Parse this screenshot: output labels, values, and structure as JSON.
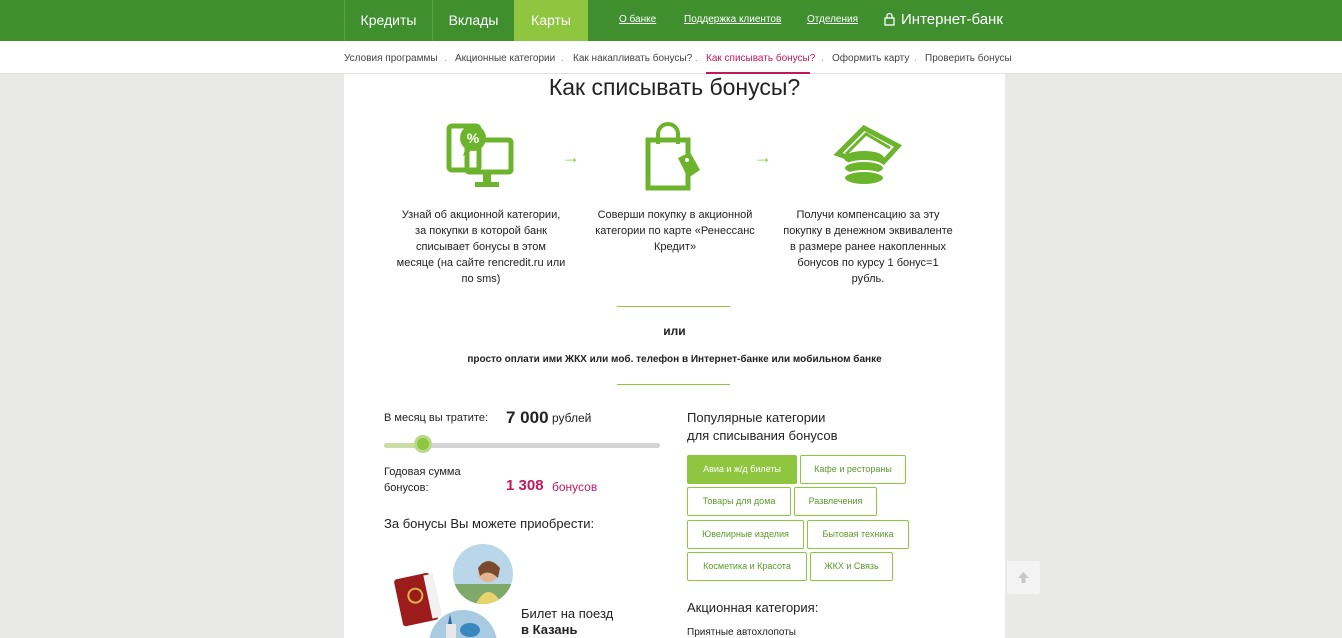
{
  "topnav": {
    "tabs": [
      {
        "label": "Кредиты",
        "active": false
      },
      {
        "label": "Вклады",
        "active": false
      },
      {
        "label": "Карты",
        "active": true
      }
    ],
    "links": [
      "О банке",
      "Поддержка клиентов",
      "Отделения"
    ],
    "internet_bank": "Интернет-банк"
  },
  "subnav": {
    "items": [
      {
        "label": "Условия программы",
        "active": false
      },
      {
        "label": "Акционные категории",
        "active": false
      },
      {
        "label": "Как накапливать бонусы?",
        "active": false
      },
      {
        "label": "Как списывать бонусы?",
        "active": true
      },
      {
        "label": "Оформить карту",
        "active": false
      },
      {
        "label": "Проверить бонусы",
        "active": false
      }
    ]
  },
  "main": {
    "heading": "Как списывать бонусы?",
    "steps": [
      {
        "icon": "device-discount-icon",
        "text": "Узнай об акционной категории, за покупки в которой банк списывает бонусы в этом месяце (на сайте rencredit.ru или по sms)"
      },
      {
        "icon": "shopping-bag-icon",
        "text": "Соверши покупку в акционной категории по карте «Ренессанс Кредит»"
      },
      {
        "icon": "coins-icon",
        "text": "Получи компенсацию за эту покупку в денежном эквиваленте в размере ранее накопленных бонусов по курсу 1 бонус=1 рубль."
      }
    ],
    "arrow": "→",
    "or": "или",
    "simply": "просто оплати ими ЖКХ или моб. телефон в Интернет-банке или мобильном банке"
  },
  "calculator": {
    "spend_label": "В месяц вы тратите:",
    "spend_value": "7 000",
    "spend_unit": "рублей",
    "slider_fraction": 0.14,
    "annual_label": "Годовая сумма бонусов:",
    "annual_value": "1 308",
    "annual_unit": "бонусов",
    "buy_title": "За бонусы Вы можете приобрести:",
    "offer_line1": "Билет на поезд",
    "offer_line2": "в Казань"
  },
  "categories": {
    "title_line1": "Популярные категории",
    "title_line2": "для списывания бонусов",
    "chips": [
      {
        "label": "Авиа и ж/д билеты",
        "active": true
      },
      {
        "label": "Кафе и рестораны",
        "active": false
      },
      {
        "label": "Товары для дома",
        "active": false
      },
      {
        "label": "Развлечения",
        "active": false
      },
      {
        "label": "Ювелирные изделия",
        "active": false
      },
      {
        "label": "Бытовая техника",
        "active": false
      },
      {
        "label": "Косметика и Красота",
        "active": false
      },
      {
        "label": "ЖКХ и Связь",
        "active": false
      }
    ],
    "action_title": "Акционная категория:",
    "action_value": "Приятные автохлопоты"
  },
  "colors": {
    "header_green": "#3f8f2f",
    "accent_green": "#8ec63f",
    "accent_pink": "#c2185b"
  }
}
